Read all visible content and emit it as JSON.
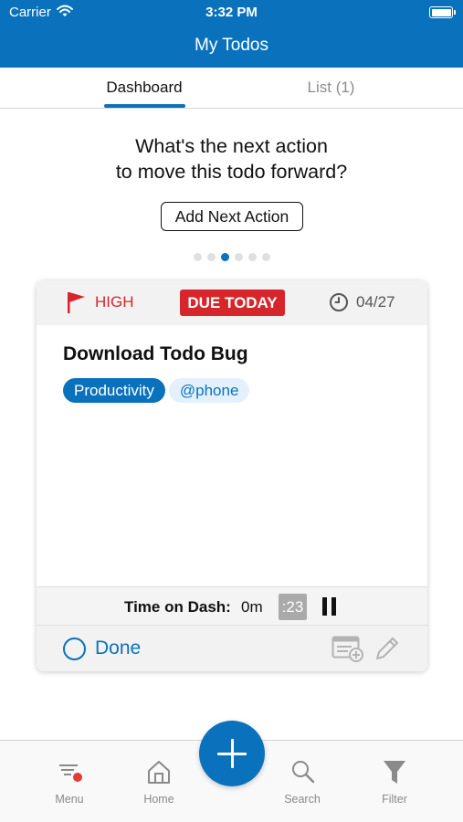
{
  "status_bar": {
    "carrier": "Carrier",
    "time": "3:32 PM"
  },
  "header": {
    "title": "My Todos"
  },
  "tabs": [
    {
      "label": "Dashboard",
      "selected": true
    },
    {
      "label": "List (1)",
      "selected": false
    }
  ],
  "prompt": {
    "line1": "What's the next action",
    "line2": "to move this todo forward?"
  },
  "add_next_action_label": "Add Next Action",
  "page_indicator": {
    "count": 6,
    "active_index": 2
  },
  "todo": {
    "priority": "HIGH",
    "due_badge": "DUE TODAY",
    "due_date": "04/27",
    "title": "Download Todo Bug",
    "tags": [
      "Productivity",
      "@phone"
    ],
    "time_on_dash_label": "Time on Dash:",
    "time_on_dash_minutes": "0m",
    "time_on_dash_seconds": ":23",
    "done_label": "Done"
  },
  "tab_bar": {
    "menu": "Menu",
    "home": "Home",
    "search": "Search",
    "filter": "Filter"
  },
  "colors": {
    "brand": "#0a72bd",
    "danger": "#d7262b",
    "muted": "#888888"
  },
  "icons": [
    "wifi-icon",
    "battery-icon",
    "flag-icon",
    "clock-icon",
    "pause-icon",
    "done-circle-icon",
    "add-to-list-icon",
    "pencil-icon",
    "menu-icon",
    "home-icon",
    "plus-icon",
    "search-icon",
    "filter-icon"
  ]
}
